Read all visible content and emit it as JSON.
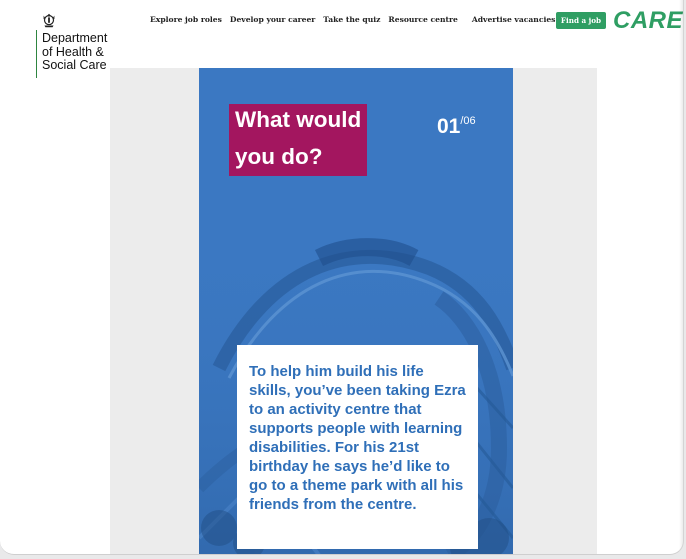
{
  "header": {
    "logo_lines": [
      "Department",
      "of Health &",
      "Social Care"
    ],
    "nav": [
      {
        "label": "Explore job roles"
      },
      {
        "label": "Develop your career"
      },
      {
        "label": "Take the quiz"
      },
      {
        "label": "Resource centre"
      },
      {
        "label": "Advertise vacancies"
      }
    ],
    "find_job_label": "Find a job",
    "care_logo": "CARE",
    "colors": {
      "brand_green": "#2f9e63",
      "crest_green": "#2e8540"
    }
  },
  "quiz": {
    "title_line1": "What would",
    "title_line2": "you do?",
    "counter_current": "01",
    "counter_total": "/06",
    "scenario": "To help him build his life skills, you’ve been taking Ezra to an activity centre that supports people with learning disabilities. For his 21st birthday he says he’d like to go to a theme park with all his friends from the centre.",
    "colors": {
      "card_blue": "#3b78c2",
      "title_magenta": "#a3165f",
      "scenario_text": "#2f6fb8"
    }
  }
}
